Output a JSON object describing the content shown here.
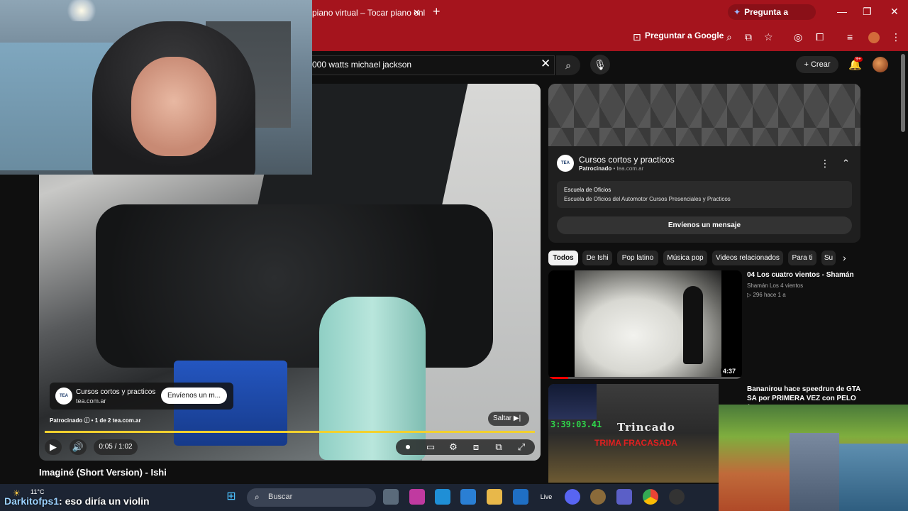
{
  "browser": {
    "tab_title": "piano virtual – Tocar piano onli",
    "gemini_label": "Pregunta a Gemini",
    "ask_google_label": "Preguntar a Google"
  },
  "youtube": {
    "search_value": "000 watts michael jackson",
    "create_label": "Crear",
    "notification_count": "9+"
  },
  "player": {
    "ad_card": {
      "logo": "TEA",
      "title": "Cursos cortos y practicos",
      "domain": "tea.com.ar",
      "cta": "Envíenos un m..."
    },
    "ad_meta": "Patrocinado  ⓘ • 1 de 2    tea.com.ar",
    "skip_label": "Saltar",
    "time": "0:05 / 1:02",
    "progress": 0.08,
    "video_title": "Imaginé (Short Version) - Ishi"
  },
  "side_ad": {
    "logo": "TEA",
    "title": "Cursos cortos y practicos",
    "sponsored": "Patrocinado",
    "domain": " • tea.com.ar",
    "box_title": "Escuela de Oficios",
    "box_text": "Escuela de Oficios del Automotor Cursos Presenciales y Practicos",
    "cta": "Envíenos un mensaje"
  },
  "chips": [
    {
      "label": "Todos",
      "active": true
    },
    {
      "label": "De Ishi",
      "active": false
    },
    {
      "label": "Pop latino",
      "active": false
    },
    {
      "label": "Música pop",
      "active": false
    },
    {
      "label": "Videos relacionados",
      "active": false
    },
    {
      "label": "Para ti",
      "active": false
    },
    {
      "label": "Su",
      "active": false
    }
  ],
  "recommendations": [
    {
      "title": "04 Los cuatro vientos - Shamán",
      "channel": "Shamán Los 4 vientos",
      "meta": "▷ 296  hace 1 a",
      "duration": "4:37"
    },
    {
      "title": "Bananirou hace speedrun de GTA SA por PRIMERA VEZ con PELO (cuenta",
      "timer": "3:39:03.41",
      "thumb_logo": "Trincado",
      "thumb_red": "TRIMA FRACASADA"
    }
  ],
  "taskbar": {
    "temperature": "11°C",
    "search_placeholder": "Buscar",
    "live_label": "Live"
  },
  "stream_caption": {
    "name": "Darkitofps1",
    "message": ": eso diría un violin"
  }
}
